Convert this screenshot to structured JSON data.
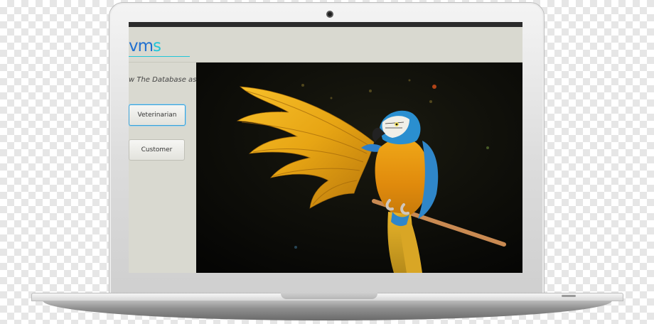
{
  "app": {
    "logo_text": "vms",
    "view_label": "w The Database as",
    "buttons": {
      "veterinarian": "Veterinarian",
      "customer": "Customer"
    },
    "hero_image": "parrot-photo"
  },
  "colors": {
    "logo_primary": "#1f6fd0",
    "logo_accent": "#20c6d8",
    "panel_bg": "#d9d9d0",
    "selected_button_border": "#3aa1d6"
  }
}
